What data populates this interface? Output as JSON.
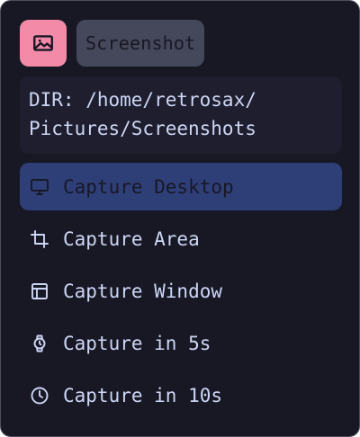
{
  "header": {
    "icon": "image-icon",
    "title": "Screenshot"
  },
  "directory": {
    "text": "DIR: /home/retrosax/\nPictures/Screenshots"
  },
  "menu": {
    "items": [
      {
        "label": "Capture Desktop",
        "icon": "monitor-icon",
        "active": true
      },
      {
        "label": "Capture Area",
        "icon": "crop-icon",
        "active": false
      },
      {
        "label": "Capture Window",
        "icon": "window-layout-icon",
        "active": false
      },
      {
        "label": "Capture in 5s",
        "icon": "watch-icon",
        "active": false
      },
      {
        "label": "Capture in 10s",
        "icon": "clock-icon",
        "active": false
      }
    ]
  },
  "colors": {
    "background": "#181825",
    "accent_icon_bg": "#f38ba8",
    "title_pill_bg": "#45475a",
    "active_item_bg": "#2e3f78",
    "text": "#cdd6f4"
  }
}
